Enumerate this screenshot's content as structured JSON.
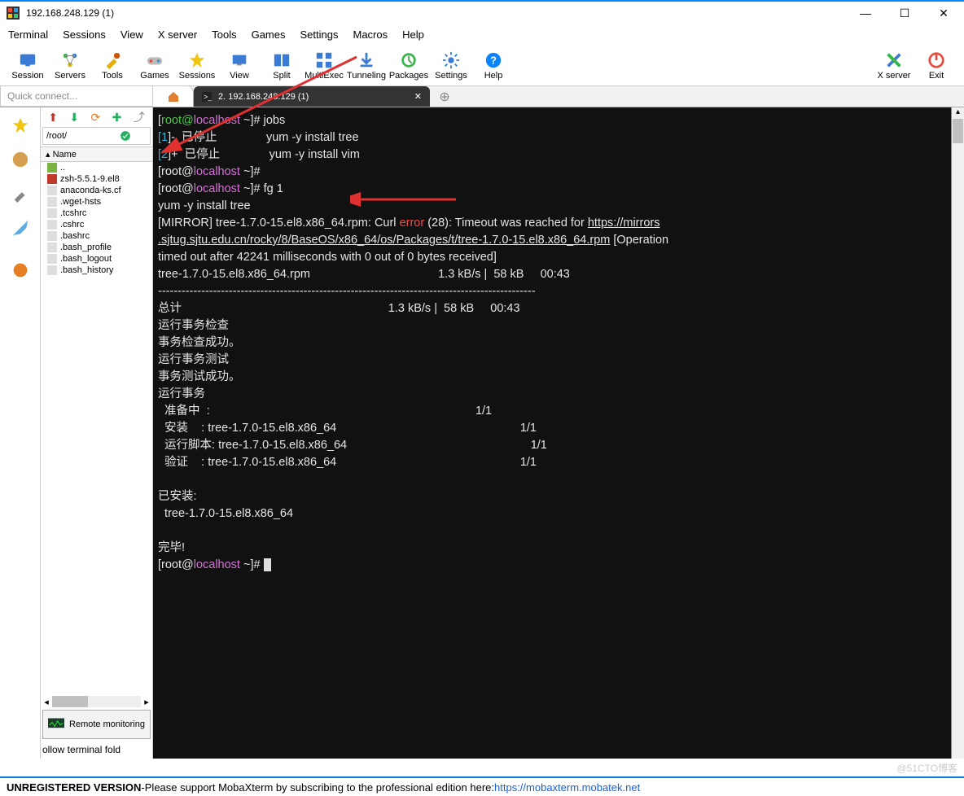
{
  "window": {
    "title": "192.168.248.129 (1)",
    "minimize": "—",
    "maximize": "☐",
    "close": "✕"
  },
  "menu": {
    "items": [
      "Terminal",
      "Sessions",
      "View",
      "X server",
      "Tools",
      "Games",
      "Settings",
      "Macros",
      "Help"
    ]
  },
  "toolbar": {
    "items": [
      {
        "label": "Session",
        "color": "#3a7bd5"
      },
      {
        "label": "Servers",
        "color": "#3ab54a"
      },
      {
        "label": "Tools",
        "color": "#e2b007"
      },
      {
        "label": "Games",
        "color": "#8e44ad"
      },
      {
        "label": "Sessions",
        "color": "#e2b007"
      },
      {
        "label": "View",
        "color": "#3a7bd5"
      },
      {
        "label": "Split",
        "color": "#3a7bd5"
      },
      {
        "label": "MultiExec",
        "color": "#3a7bd5"
      },
      {
        "label": "Tunneling",
        "color": "#3a7bd5"
      },
      {
        "label": "Packages",
        "color": "#3ab54a"
      },
      {
        "label": "Settings",
        "color": "#3a7bd5"
      },
      {
        "label": "Help",
        "color": "#0a84ff"
      }
    ],
    "right_items": [
      {
        "label": "X server"
      },
      {
        "label": "Exit"
      }
    ]
  },
  "tabs": {
    "quick_connect_placeholder": "Quick connect...",
    "active_label": "2. 192.168.248.129 (1)",
    "close": "✕",
    "new": "⊕"
  },
  "file_panel": {
    "path": "/root/",
    "header": "Name",
    "items": [
      "..",
      "zsh-5.5.1-9.el8",
      "anaconda-ks.cf",
      ".wget-hsts",
      ".tcshrc",
      ".cshrc",
      ".bashrc",
      ".bash_profile",
      ".bash_logout",
      ".bash_history"
    ],
    "remote_monitoring": "Remote monitoring",
    "follow": "ollow terminal fold"
  },
  "terminal": {
    "l1_a": "root@",
    "l1_b": "localhost",
    "l1_c": " ~]# ",
    "l1_d": "jobs",
    "l2_a": "[",
    "l2_b": "1",
    "l2_c": "]-  已停止               yum -y install tree",
    "l3_a": "[",
    "l3_b": "2",
    "l3_c": "]+  已停止               yum -y install vim",
    "l4_a": "[root@",
    "l4_b": "localhost",
    "l4_c": " ~]#",
    "l5_a": "[root@",
    "l5_b": "localhost",
    "l5_c": " ~]# ",
    "l5_d": "fg 1",
    "l6": "yum -y install tree",
    "l7_a": "[MIRROR] tree-1.7.0-15.el8.x86_64.rpm: Curl ",
    "l7_b": "error",
    "l7_c": " (28): Timeout was reached for ",
    "l7_d": "https://mirrors",
    "l8_a": ".sjtug.sjtu.edu.cn/rocky/8/BaseOS/x86_64/os/Packages/t/tree-1.7.0-15.el8.x86_64.rpm",
    "l8_b": " [Operation",
    "l9": "timed out after 42241 milliseconds with 0 out of 0 bytes received]",
    "l10": "tree-1.7.0-15.el8.x86_64.rpm                                       1.3 kB/s |  58 kB     00:43",
    "l11": "------------------------------------------------------------------------------------------------",
    "l12": "总计                                                               1.3 kB/s |  58 kB     00:43",
    "l13": "运行事务检查",
    "l14": "事务检查成功。",
    "l15": "运行事务测试",
    "l16": "事务测试成功。",
    "l17": "运行事务",
    "l18": "  准备中  :                                                                                 1/1",
    "l19": "  安装    : tree-1.7.0-15.el8.x86_64                                                        1/1",
    "l20": "  运行脚本: tree-1.7.0-15.el8.x86_64                                                        1/1",
    "l21": "  验证    : tree-1.7.0-15.el8.x86_64                                                        1/1",
    "l22": "",
    "l23": "已安装:",
    "l24": "  tree-1.7.0-15.el8.x86_64",
    "l25": "",
    "l26": "完毕!",
    "l27_a": "[root@",
    "l27_b": "localhost",
    "l27_c": " ~]# "
  },
  "footer": {
    "left": "UNREGISTERED VERSION",
    "sep": "  -  ",
    "mid": "Please support MobaXterm by subscribing to the professional edition here:  ",
    "link": "https://mobaxterm.mobatek.net"
  },
  "watermark": "@51CTO博客"
}
